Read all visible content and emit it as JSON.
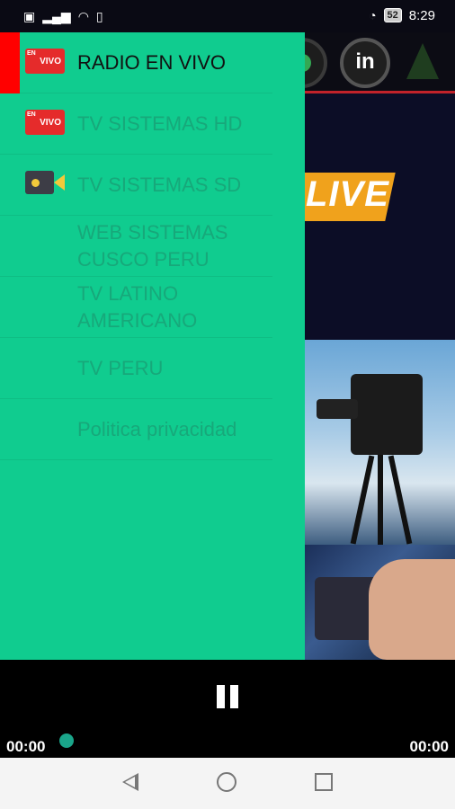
{
  "status_bar": {
    "time": "8:29",
    "battery": "52",
    "icons": [
      "notification-icon",
      "signal-icon",
      "wifi-icon",
      "vibrate-icon",
      "data-saver-icon"
    ]
  },
  "background_app": {
    "topbar_icons": [
      "whatsapp-icon",
      "linkedin-icon",
      "tree-icon"
    ],
    "linkedin_label": "in",
    "live_text": "LIVE"
  },
  "drawer": {
    "items": [
      {
        "label": "RADIO EN VIVO",
        "icon": "en-vivo-icon",
        "active": true
      },
      {
        "label": "TV SISTEMAS HD",
        "icon": "en-vivo-icon",
        "active": false
      },
      {
        "label": "TV SISTEMAS SD",
        "icon": "video-camera-icon",
        "active": false
      },
      {
        "label": "WEB SISTEMAS CUSCO PERU",
        "icon": "",
        "active": false
      },
      {
        "label": "TV LATINO AMERICANO",
        "icon": "",
        "active": false
      },
      {
        "label": "TV PERU",
        "icon": "",
        "active": false
      },
      {
        "label": "Politica privacidad",
        "icon": "",
        "active": false
      }
    ],
    "envivo_text": "VIVO",
    "accent_color": "#10cc8f",
    "active_indicator_color": "#ff0000"
  },
  "player": {
    "elapsed": "00:00",
    "duration": "00:00",
    "progress": 0,
    "state_icon": "pause-icon"
  },
  "nav_bar": {
    "icons": [
      "back-icon",
      "home-icon",
      "recents-icon"
    ]
  }
}
